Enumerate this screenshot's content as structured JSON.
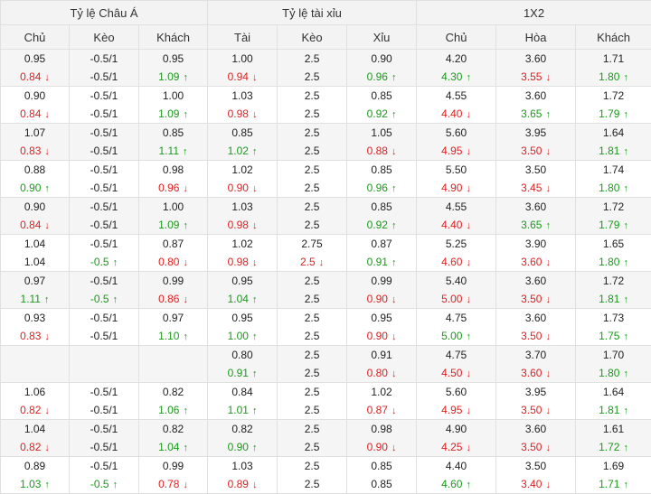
{
  "header": {
    "groups": [
      "Tỷ lệ Châu Á",
      "Tỷ lệ tài xỉu",
      "1X2"
    ],
    "columns": [
      "Chủ",
      "Kèo",
      "Khách",
      "Tài",
      "Kèo",
      "Xỉu",
      "Chủ",
      "Hòa",
      "Khách"
    ]
  },
  "colors": {
    "up": "#1a9a1a",
    "down": "#e02020",
    "neutral": "#222222"
  },
  "rows": [
    {
      "cells": [
        [
          {
            "v": "0.95",
            "d": ""
          },
          {
            "v": "0.84",
            "d": "down"
          }
        ],
        [
          {
            "v": "-0.5/1",
            "d": ""
          },
          {
            "v": "-0.5/1",
            "d": ""
          }
        ],
        [
          {
            "v": "0.95",
            "d": ""
          },
          {
            "v": "1.09",
            "d": "up"
          }
        ],
        [
          {
            "v": "1.00",
            "d": ""
          },
          {
            "v": "0.94",
            "d": "down"
          }
        ],
        [
          {
            "v": "2.5",
            "d": ""
          },
          {
            "v": "2.5",
            "d": ""
          }
        ],
        [
          {
            "v": "0.90",
            "d": ""
          },
          {
            "v": "0.96",
            "d": "up"
          }
        ],
        [
          {
            "v": "4.20",
            "d": ""
          },
          {
            "v": "4.30",
            "d": "up"
          }
        ],
        [
          {
            "v": "3.60",
            "d": ""
          },
          {
            "v": "3.55",
            "d": "down"
          }
        ],
        [
          {
            "v": "1.71",
            "d": ""
          },
          {
            "v": "1.80",
            "d": "up"
          }
        ]
      ]
    },
    {
      "cells": [
        [
          {
            "v": "0.90",
            "d": ""
          },
          {
            "v": "0.84",
            "d": "down"
          }
        ],
        [
          {
            "v": "-0.5/1",
            "d": ""
          },
          {
            "v": "-0.5/1",
            "d": ""
          }
        ],
        [
          {
            "v": "1.00",
            "d": ""
          },
          {
            "v": "1.09",
            "d": "up"
          }
        ],
        [
          {
            "v": "1.03",
            "d": ""
          },
          {
            "v": "0.98",
            "d": "down"
          }
        ],
        [
          {
            "v": "2.5",
            "d": ""
          },
          {
            "v": "2.5",
            "d": ""
          }
        ],
        [
          {
            "v": "0.85",
            "d": ""
          },
          {
            "v": "0.92",
            "d": "up"
          }
        ],
        [
          {
            "v": "4.55",
            "d": ""
          },
          {
            "v": "4.40",
            "d": "down"
          }
        ],
        [
          {
            "v": "3.60",
            "d": ""
          },
          {
            "v": "3.65",
            "d": "up"
          }
        ],
        [
          {
            "v": "1.72",
            "d": ""
          },
          {
            "v": "1.79",
            "d": "up"
          }
        ]
      ]
    },
    {
      "cells": [
        [
          {
            "v": "1.07",
            "d": ""
          },
          {
            "v": "0.83",
            "d": "down"
          }
        ],
        [
          {
            "v": "-0.5/1",
            "d": ""
          },
          {
            "v": "-0.5/1",
            "d": ""
          }
        ],
        [
          {
            "v": "0.85",
            "d": ""
          },
          {
            "v": "1.11",
            "d": "up"
          }
        ],
        [
          {
            "v": "0.85",
            "d": ""
          },
          {
            "v": "1.02",
            "d": "up"
          }
        ],
        [
          {
            "v": "2.5",
            "d": ""
          },
          {
            "v": "2.5",
            "d": ""
          }
        ],
        [
          {
            "v": "1.05",
            "d": ""
          },
          {
            "v": "0.88",
            "d": "down"
          }
        ],
        [
          {
            "v": "5.60",
            "d": ""
          },
          {
            "v": "4.95",
            "d": "down"
          }
        ],
        [
          {
            "v": "3.95",
            "d": ""
          },
          {
            "v": "3.50",
            "d": "down"
          }
        ],
        [
          {
            "v": "1.64",
            "d": ""
          },
          {
            "v": "1.81",
            "d": "up"
          }
        ]
      ]
    },
    {
      "cells": [
        [
          {
            "v": "0.88",
            "d": ""
          },
          {
            "v": "0.90",
            "d": "up"
          }
        ],
        [
          {
            "v": "-0.5/1",
            "d": ""
          },
          {
            "v": "-0.5/1",
            "d": ""
          }
        ],
        [
          {
            "v": "0.98",
            "d": ""
          },
          {
            "v": "0.96",
            "d": "down"
          }
        ],
        [
          {
            "v": "1.02",
            "d": ""
          },
          {
            "v": "0.90",
            "d": "down"
          }
        ],
        [
          {
            "v": "2.5",
            "d": ""
          },
          {
            "v": "2.5",
            "d": ""
          }
        ],
        [
          {
            "v": "0.85",
            "d": ""
          },
          {
            "v": "0.96",
            "d": "up"
          }
        ],
        [
          {
            "v": "5.50",
            "d": ""
          },
          {
            "v": "4.90",
            "d": "down"
          }
        ],
        [
          {
            "v": "3.50",
            "d": ""
          },
          {
            "v": "3.45",
            "d": "down"
          }
        ],
        [
          {
            "v": "1.74",
            "d": ""
          },
          {
            "v": "1.80",
            "d": "up"
          }
        ]
      ]
    },
    {
      "cells": [
        [
          {
            "v": "0.90",
            "d": ""
          },
          {
            "v": "0.84",
            "d": "down"
          }
        ],
        [
          {
            "v": "-0.5/1",
            "d": ""
          },
          {
            "v": "-0.5/1",
            "d": ""
          }
        ],
        [
          {
            "v": "1.00",
            "d": ""
          },
          {
            "v": "1.09",
            "d": "up"
          }
        ],
        [
          {
            "v": "1.03",
            "d": ""
          },
          {
            "v": "0.98",
            "d": "down"
          }
        ],
        [
          {
            "v": "2.5",
            "d": ""
          },
          {
            "v": "2.5",
            "d": ""
          }
        ],
        [
          {
            "v": "0.85",
            "d": ""
          },
          {
            "v": "0.92",
            "d": "up"
          }
        ],
        [
          {
            "v": "4.55",
            "d": ""
          },
          {
            "v": "4.40",
            "d": "down"
          }
        ],
        [
          {
            "v": "3.60",
            "d": ""
          },
          {
            "v": "3.65",
            "d": "up"
          }
        ],
        [
          {
            "v": "1.72",
            "d": ""
          },
          {
            "v": "1.79",
            "d": "up"
          }
        ]
      ]
    },
    {
      "cells": [
        [
          {
            "v": "1.04",
            "d": ""
          },
          {
            "v": "1.04",
            "d": ""
          }
        ],
        [
          {
            "v": "-0.5/1",
            "d": ""
          },
          {
            "v": "-0.5",
            "d": "up"
          }
        ],
        [
          {
            "v": "0.87",
            "d": ""
          },
          {
            "v": "0.80",
            "d": "down"
          }
        ],
        [
          {
            "v": "1.02",
            "d": ""
          },
          {
            "v": "0.98",
            "d": "down"
          }
        ],
        [
          {
            "v": "2.75",
            "d": ""
          },
          {
            "v": "2.5",
            "d": "down"
          }
        ],
        [
          {
            "v": "0.87",
            "d": ""
          },
          {
            "v": "0.91",
            "d": "up"
          }
        ],
        [
          {
            "v": "5.25",
            "d": ""
          },
          {
            "v": "4.60",
            "d": "down"
          }
        ],
        [
          {
            "v": "3.90",
            "d": ""
          },
          {
            "v": "3.60",
            "d": "down"
          }
        ],
        [
          {
            "v": "1.65",
            "d": ""
          },
          {
            "v": "1.80",
            "d": "up"
          }
        ]
      ]
    },
    {
      "cells": [
        [
          {
            "v": "0.97",
            "d": ""
          },
          {
            "v": "1.11",
            "d": "up"
          }
        ],
        [
          {
            "v": "-0.5/1",
            "d": ""
          },
          {
            "v": "-0.5",
            "d": "up"
          }
        ],
        [
          {
            "v": "0.99",
            "d": ""
          },
          {
            "v": "0.86",
            "d": "down"
          }
        ],
        [
          {
            "v": "0.95",
            "d": ""
          },
          {
            "v": "1.04",
            "d": "up"
          }
        ],
        [
          {
            "v": "2.5",
            "d": ""
          },
          {
            "v": "2.5",
            "d": ""
          }
        ],
        [
          {
            "v": "0.99",
            "d": ""
          },
          {
            "v": "0.90",
            "d": "down"
          }
        ],
        [
          {
            "v": "5.40",
            "d": ""
          },
          {
            "v": "5.00",
            "d": "down"
          }
        ],
        [
          {
            "v": "3.60",
            "d": ""
          },
          {
            "v": "3.50",
            "d": "down"
          }
        ],
        [
          {
            "v": "1.72",
            "d": ""
          },
          {
            "v": "1.81",
            "d": "up"
          }
        ]
      ]
    },
    {
      "cells": [
        [
          {
            "v": "0.93",
            "d": ""
          },
          {
            "v": "0.83",
            "d": "down"
          }
        ],
        [
          {
            "v": "-0.5/1",
            "d": ""
          },
          {
            "v": "-0.5/1",
            "d": ""
          }
        ],
        [
          {
            "v": "0.97",
            "d": ""
          },
          {
            "v": "1.10",
            "d": "up"
          }
        ],
        [
          {
            "v": "0.95",
            "d": ""
          },
          {
            "v": "1.00",
            "d": "up"
          }
        ],
        [
          {
            "v": "2.5",
            "d": ""
          },
          {
            "v": "2.5",
            "d": ""
          }
        ],
        [
          {
            "v": "0.95",
            "d": ""
          },
          {
            "v": "0.90",
            "d": "down"
          }
        ],
        [
          {
            "v": "4.75",
            "d": ""
          },
          {
            "v": "5.00",
            "d": "up"
          }
        ],
        [
          {
            "v": "3.60",
            "d": ""
          },
          {
            "v": "3.50",
            "d": "down"
          }
        ],
        [
          {
            "v": "1.73",
            "d": ""
          },
          {
            "v": "1.75",
            "d": "up"
          }
        ]
      ]
    },
    {
      "cells": [
        [
          {
            "v": "",
            "d": ""
          },
          {
            "v": "",
            "d": ""
          }
        ],
        [
          {
            "v": "",
            "d": ""
          },
          {
            "v": "",
            "d": ""
          }
        ],
        [
          {
            "v": "",
            "d": ""
          },
          {
            "v": "",
            "d": ""
          }
        ],
        [
          {
            "v": "0.80",
            "d": ""
          },
          {
            "v": "0.91",
            "d": "up"
          }
        ],
        [
          {
            "v": "2.5",
            "d": ""
          },
          {
            "v": "2.5",
            "d": ""
          }
        ],
        [
          {
            "v": "0.91",
            "d": ""
          },
          {
            "v": "0.80",
            "d": "down"
          }
        ],
        [
          {
            "v": "4.75",
            "d": ""
          },
          {
            "v": "4.50",
            "d": "down"
          }
        ],
        [
          {
            "v": "3.70",
            "d": ""
          },
          {
            "v": "3.60",
            "d": "down"
          }
        ],
        [
          {
            "v": "1.70",
            "d": ""
          },
          {
            "v": "1.80",
            "d": "up"
          }
        ]
      ]
    },
    {
      "cells": [
        [
          {
            "v": "1.06",
            "d": ""
          },
          {
            "v": "0.82",
            "d": "down"
          }
        ],
        [
          {
            "v": "-0.5/1",
            "d": ""
          },
          {
            "v": "-0.5/1",
            "d": ""
          }
        ],
        [
          {
            "v": "0.82",
            "d": ""
          },
          {
            "v": "1.06",
            "d": "up"
          }
        ],
        [
          {
            "v": "0.84",
            "d": ""
          },
          {
            "v": "1.01",
            "d": "up"
          }
        ],
        [
          {
            "v": "2.5",
            "d": ""
          },
          {
            "v": "2.5",
            "d": ""
          }
        ],
        [
          {
            "v": "1.02",
            "d": ""
          },
          {
            "v": "0.87",
            "d": "down"
          }
        ],
        [
          {
            "v": "5.60",
            "d": ""
          },
          {
            "v": "4.95",
            "d": "down"
          }
        ],
        [
          {
            "v": "3.95",
            "d": ""
          },
          {
            "v": "3.50",
            "d": "down"
          }
        ],
        [
          {
            "v": "1.64",
            "d": ""
          },
          {
            "v": "1.81",
            "d": "up"
          }
        ]
      ]
    },
    {
      "cells": [
        [
          {
            "v": "1.04",
            "d": ""
          },
          {
            "v": "0.82",
            "d": "down"
          }
        ],
        [
          {
            "v": "-0.5/1",
            "d": ""
          },
          {
            "v": "-0.5/1",
            "d": ""
          }
        ],
        [
          {
            "v": "0.82",
            "d": ""
          },
          {
            "v": "1.04",
            "d": "up"
          }
        ],
        [
          {
            "v": "0.82",
            "d": ""
          },
          {
            "v": "0.90",
            "d": "up"
          }
        ],
        [
          {
            "v": "2.5",
            "d": ""
          },
          {
            "v": "2.5",
            "d": ""
          }
        ],
        [
          {
            "v": "0.98",
            "d": ""
          },
          {
            "v": "0.90",
            "d": "down"
          }
        ],
        [
          {
            "v": "4.90",
            "d": ""
          },
          {
            "v": "4.25",
            "d": "down"
          }
        ],
        [
          {
            "v": "3.60",
            "d": ""
          },
          {
            "v": "3.50",
            "d": "down"
          }
        ],
        [
          {
            "v": "1.61",
            "d": ""
          },
          {
            "v": "1.72",
            "d": "up"
          }
        ]
      ]
    },
    {
      "cells": [
        [
          {
            "v": "0.89",
            "d": ""
          },
          {
            "v": "1.03",
            "d": "up"
          }
        ],
        [
          {
            "v": "-0.5/1",
            "d": ""
          },
          {
            "v": "-0.5",
            "d": "up"
          }
        ],
        [
          {
            "v": "0.99",
            "d": ""
          },
          {
            "v": "0.78",
            "d": "down"
          }
        ],
        [
          {
            "v": "1.03",
            "d": ""
          },
          {
            "v": "0.89",
            "d": "down"
          }
        ],
        [
          {
            "v": "2.5",
            "d": ""
          },
          {
            "v": "2.5",
            "d": ""
          }
        ],
        [
          {
            "v": "0.85",
            "d": ""
          },
          {
            "v": "0.85",
            "d": ""
          }
        ],
        [
          {
            "v": "4.40",
            "d": ""
          },
          {
            "v": "4.60",
            "d": "up"
          }
        ],
        [
          {
            "v": "3.50",
            "d": ""
          },
          {
            "v": "3.40",
            "d": "down"
          }
        ],
        [
          {
            "v": "1.69",
            "d": ""
          },
          {
            "v": "1.71",
            "d": "up"
          }
        ]
      ]
    }
  ]
}
